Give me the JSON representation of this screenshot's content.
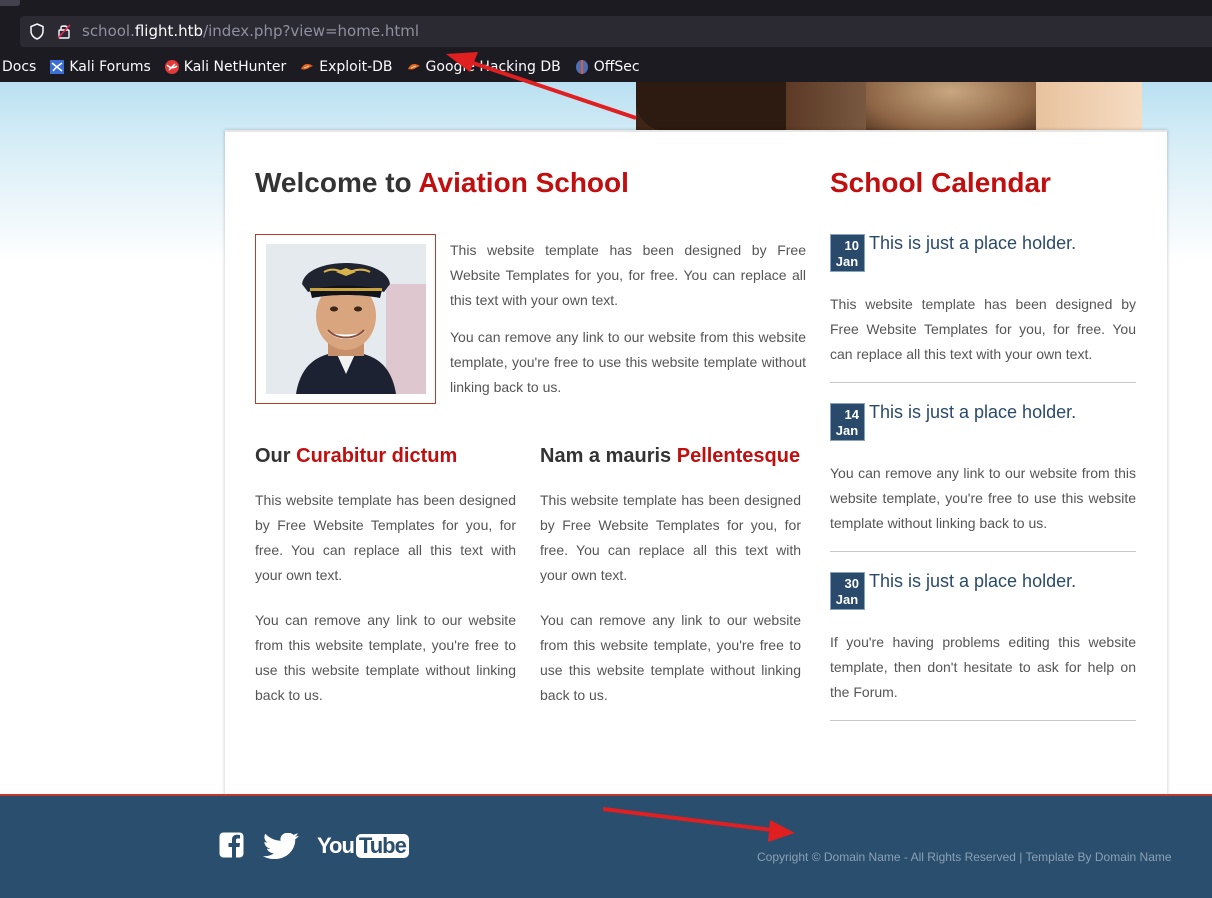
{
  "browser": {
    "url_prefix": "school.",
    "url_host": "flight.htb",
    "url_path": "/index.php?view=home.html",
    "bookmarks": [
      {
        "label": "Docs",
        "icon": "none"
      },
      {
        "label": "Kali Forums",
        "icon": "kali-forums-icon"
      },
      {
        "label": "Kali NetHunter",
        "icon": "kali-nethunter-icon"
      },
      {
        "label": "Exploit-DB",
        "icon": "exploit-db-icon"
      },
      {
        "label": "Google Hacking DB",
        "icon": "google-hacking-db-icon"
      },
      {
        "label": "OffSec",
        "icon": "offsec-icon"
      }
    ]
  },
  "main": {
    "welcome_prefix": "Welcome to ",
    "welcome_highlight": "Aviation School",
    "intro_p1": "This website template has been designed by Free Website Templates for you, for free. You can replace all this text with your own text.",
    "intro_p2": "You can remove any link to our website from this website template, you're free to use this website template without linking back to us.",
    "col1": {
      "heading_prefix": "Our ",
      "heading_highlight": "Curabitur dictum",
      "p1": "This website template has been designed by Free Website Templates for you, for free. You can replace all this text with your own text.",
      "p2": "You can remove any link to our website from this website template, you're free to use this website template without linking back to us."
    },
    "col2": {
      "heading_prefix": "Nam a mauris ",
      "heading_highlight": "Pellentesque",
      "p1": "This website template has been designed by Free Website Templates for you, for free. You can replace all this text with your own text.",
      "p2": "You can remove any link to our website from this website template, you're free to use this website template without linking back to us."
    }
  },
  "calendar": {
    "title": "School Calendar",
    "events": [
      {
        "day": "10",
        "month": "Jan",
        "title": "This is just a place holder.",
        "text": "This website template has been designed by Free Website Templates for you, for free. You can replace all this text with your own text."
      },
      {
        "day": "14",
        "month": "Jan",
        "title": "This is just a place holder.",
        "text": "You can remove any link to our website from this website template, you're free to use this website template without linking back to us."
      },
      {
        "day": "30",
        "month": "Jan",
        "title": "This is just a place holder.",
        "text": "If you're having problems editing this website template, then don't hesitate to ask for help on the Forum."
      }
    ]
  },
  "footer": {
    "copyright": "Copyright © Domain Name - All Rights Reserved | Template By Domain Name",
    "social_icons": [
      "facebook-icon",
      "twitter-icon",
      "youtube-icon"
    ],
    "youtube_text_a": "You",
    "youtube_text_b": "Tube"
  },
  "colors": {
    "accent_red": "#c10e0e",
    "navy": "#2a4a6b",
    "footer_bg": "#294e6e",
    "annotation_arrow": "#e02020"
  }
}
